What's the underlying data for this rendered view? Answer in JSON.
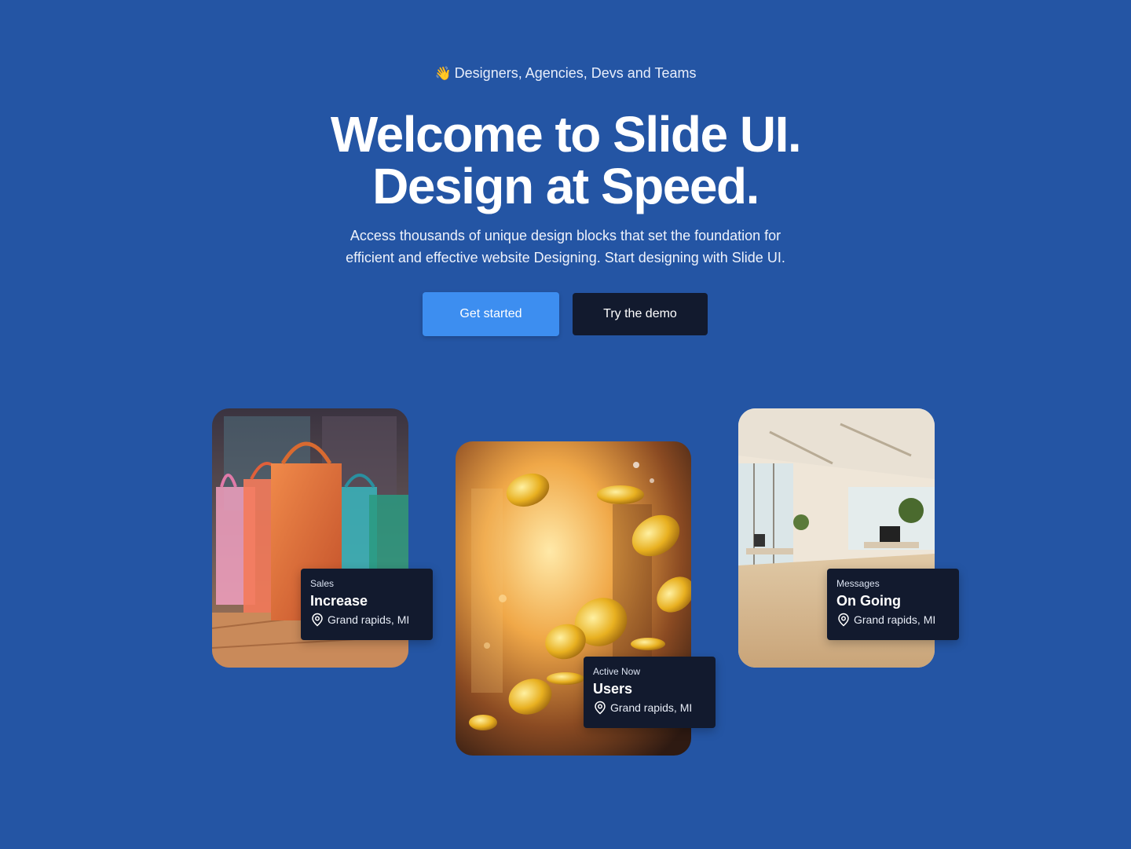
{
  "hero": {
    "eyebrow_icon": "waving-hand-icon",
    "eyebrow": "Designers, Agencies, Devs and Teams",
    "headline_line1": "Welcome to Slide UI.",
    "headline_line2": "Design at Speed.",
    "subtitle_line1": "Access thousands of unique design blocks that set the foundation for",
    "subtitle_line2": "efficient and effective website Designing. Start designing with Slide UI."
  },
  "buttons": {
    "primary": "Get started",
    "secondary": "Try the demo"
  },
  "cards": [
    {
      "image": "shopping-bags-photo",
      "label": "Sales",
      "value": "Increase",
      "location_icon": "map-pin-icon",
      "location": "Grand rapids, MI"
    },
    {
      "image": "gold-coins-photo",
      "label": "Active Now",
      "value": "Users",
      "location_icon": "map-pin-icon",
      "location": "Grand rapids, MI"
    },
    {
      "image": "office-interior-photo",
      "label": "Messages",
      "value": "On Going",
      "location_icon": "map-pin-icon",
      "location": "Grand rapids, MI"
    }
  ],
  "colors": {
    "background": "#2455a4",
    "primary_button": "#3d8ef0",
    "dark": "#121a2e"
  }
}
